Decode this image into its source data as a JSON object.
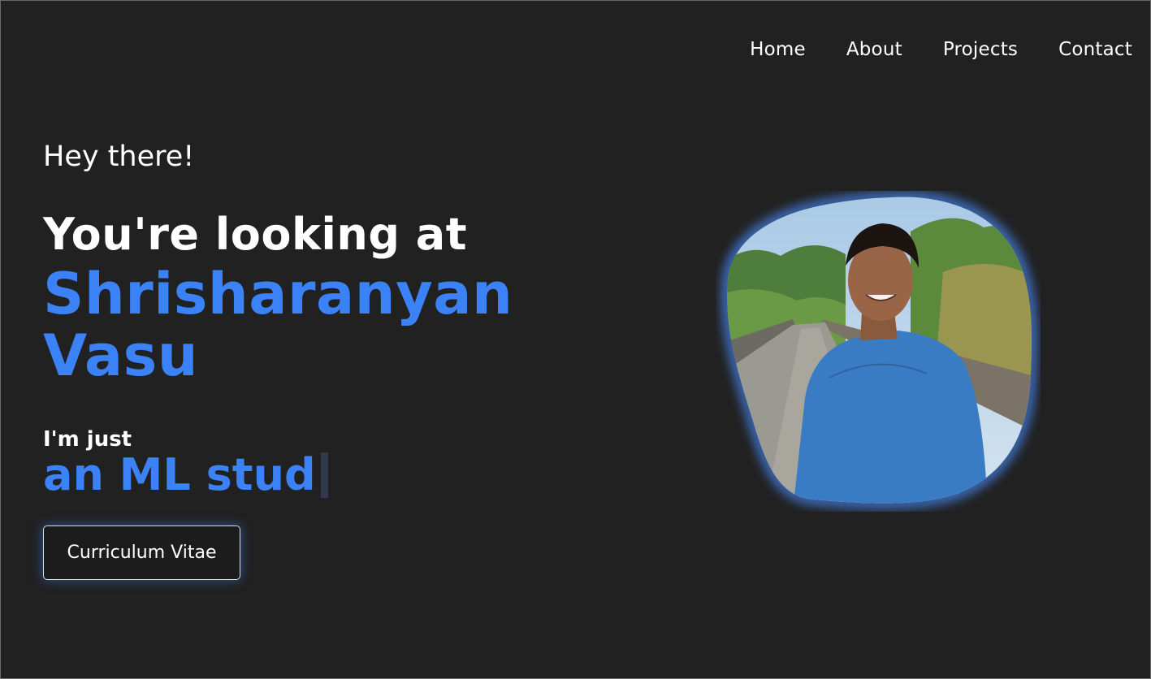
{
  "nav": {
    "items": [
      {
        "label": "Home"
      },
      {
        "label": "About"
      },
      {
        "label": "Projects"
      },
      {
        "label": "Contact"
      }
    ]
  },
  "hero": {
    "greeting": "Hey there!",
    "intro": "You're looking at",
    "name_first": "Shrisharanyan",
    "name_last": "Vasu",
    "im_just": "I'm just",
    "typed_text": "an ML stud",
    "cv_button_label": "Curriculum Vitae"
  },
  "colors": {
    "background": "#212121",
    "accent": "#3b82f6",
    "text": "#ffffff",
    "portrait_glow": "#4a8cff"
  },
  "portrait": {
    "icon": "person-portrait-photo"
  }
}
